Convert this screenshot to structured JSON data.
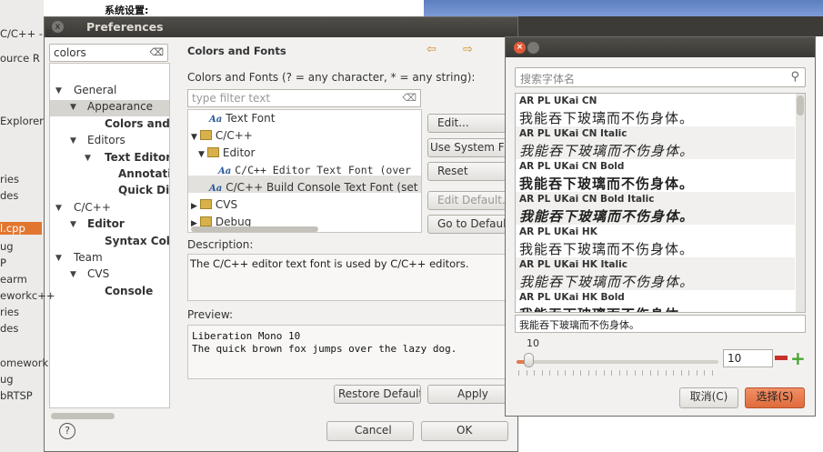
{
  "background": {
    "top_caption": "系统设置:",
    "left_items": [
      "C/C++ - E",
      "ource  R",
      "Explorer",
      "ries",
      "des",
      "l.cpp",
      "ug",
      "P",
      "earm",
      "eworkc++",
      "ries",
      "des",
      "omework",
      "ug",
      "bRTSP"
    ]
  },
  "preferences": {
    "title": "Preferences",
    "close_glyph": "x",
    "filter_value": "colors",
    "filter_clear": "⌫",
    "tree": [
      {
        "label": "General",
        "level": 0,
        "expander": "▼",
        "bold": false
      },
      {
        "label": "Appearance",
        "level": 1,
        "expander": "▼",
        "bold": false
      },
      {
        "label": "Colors and Fonts",
        "level": 2,
        "expander": "",
        "bold": true,
        "selected": true
      },
      {
        "label": "Editors",
        "level": 1,
        "expander": "▼",
        "bold": false
      },
      {
        "label": "Text Editors",
        "level": 2,
        "expander": "▼",
        "bold": true
      },
      {
        "label": "Annotations",
        "level": 3,
        "expander": "",
        "bold": true
      },
      {
        "label": "Quick Diff",
        "level": 3,
        "expander": "",
        "bold": true
      },
      {
        "label": "C/C++",
        "level": 0,
        "expander": "▼",
        "bold": false
      },
      {
        "label": "Editor",
        "level": 1,
        "expander": "▼",
        "bold": true
      },
      {
        "label": "Syntax Coloring",
        "level": 2,
        "expander": "",
        "bold": true
      },
      {
        "label": "Team",
        "level": 0,
        "expander": "▼",
        "bold": false
      },
      {
        "label": "CVS",
        "level": 1,
        "expander": "▼",
        "bold": false
      },
      {
        "label": "Console",
        "level": 2,
        "expander": "",
        "bold": true
      }
    ],
    "page_title": "Colors and Fonts",
    "nav_back": "⇦",
    "nav_forward": "⇨",
    "subtitle": "Colors and Fonts (? = any character, * = any string):",
    "type_filter_placeholder": "type filter text",
    "type_filter_clear": "⌫",
    "font_tree": [
      {
        "label": "Text Font",
        "kind": "font",
        "indent": 20,
        "mono": false
      },
      {
        "label": "C/C++",
        "kind": "folder",
        "indent": 0,
        "expander": "▼",
        "mono": false
      },
      {
        "label": "Editor",
        "kind": "folder",
        "indent": 8,
        "expander": "▼",
        "mono": false
      },
      {
        "label": "C/C++ Editor Text Font (over",
        "kind": "font",
        "indent": 30,
        "mono": true,
        "selected": true
      },
      {
        "label": "C/C++ Build Console Text Font (set to",
        "kind": "font",
        "indent": 20,
        "mono": false
      },
      {
        "label": "CVS",
        "kind": "folder",
        "indent": 0,
        "expander": "▶",
        "mono": false
      },
      {
        "label": "Debug",
        "kind": "folder",
        "indent": 0,
        "expander": "▶",
        "mono": false
      }
    ],
    "font_glyph": "Aa",
    "buttons": {
      "edit": "Edit...",
      "use_system_font": "Use System Font",
      "reset": "Reset",
      "edit_default": "Edit Default...",
      "go_to_default": "Go to Default"
    },
    "description_label": "Description:",
    "description": "The C/C++ editor text font is used by C/C++ editors.",
    "preview_label": "Preview:",
    "preview_lines": [
      "Liberation Mono 10",
      "The quick brown fox jumps over the lazy dog."
    ],
    "restore_defaults": "Restore Defaults",
    "apply": "Apply",
    "help": "?",
    "cancel": "Cancel",
    "ok": "OK"
  },
  "font_chooser": {
    "search_placeholder": "搜索字体名",
    "search_icon": "🔍",
    "sample_text": "我能吞下玻璃而不伤身体。",
    "fonts": [
      {
        "name": "AR PL UKai CN",
        "style": "normal"
      },
      {
        "name": "AR PL UKai CN Italic",
        "style": "italic"
      },
      {
        "name": "AR PL UKai CN Bold",
        "style": "bold"
      },
      {
        "name": "AR PL UKai CN Bold Italic",
        "style": "bold-italic"
      },
      {
        "name": "AR PL UKai HK",
        "style": "normal"
      },
      {
        "name": "AR PL UKai HK Italic",
        "style": "italic"
      },
      {
        "name": "AR PL UKai HK Bold",
        "style": "bold"
      }
    ],
    "preview_text": "我能吞下玻璃而不伤身体。",
    "size_label": "10",
    "size_value": "10",
    "minus": "−",
    "plus": "+",
    "cancel": "取消(C)",
    "select": "选择(S)",
    "accent": "#e06a3c"
  }
}
